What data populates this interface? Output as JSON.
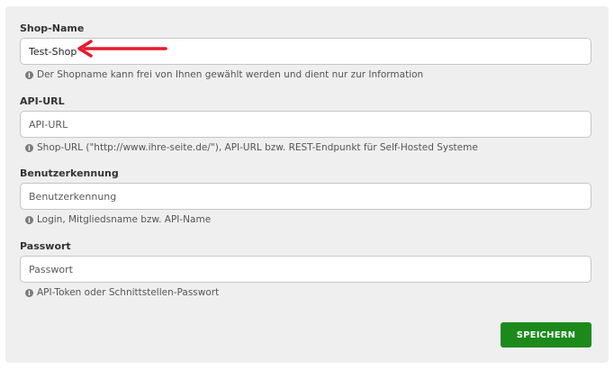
{
  "form": {
    "shop_name": {
      "label": "Shop-Name",
      "value": "Test-Shop",
      "hint": "Der Shopname kann frei von Ihnen gewählt werden und dient nur zur Information"
    },
    "api_url": {
      "label": "API-URL",
      "placeholder": "API-URL",
      "hint": "Shop-URL (\"http://www.ihre-seite.de/\"), API-URL bzw. REST-Endpunkt für Self-Hosted Systeme"
    },
    "username": {
      "label": "Benutzerkennung",
      "placeholder": "Benutzerkennung",
      "hint": "Login, Mitgliedsname bzw. API-Name"
    },
    "password": {
      "label": "Passwort",
      "placeholder": "Passwort",
      "hint": "API-Token oder Schnittstellen-Passwort"
    },
    "save_label": "SPEICHERN",
    "info_icon_glyph": "i"
  },
  "annotation": {
    "icon": "red-arrow-icon",
    "color": "#e8182d"
  },
  "colors": {
    "panel": "#efefef",
    "button": "#1b8a1b"
  }
}
